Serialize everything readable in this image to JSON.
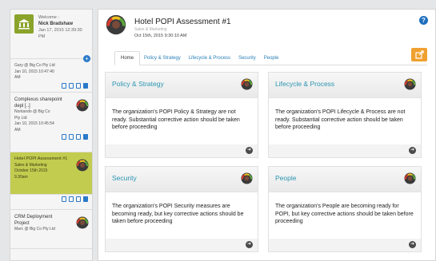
{
  "sidebar": {
    "welcome": {
      "greeting": "Welcome :",
      "name": "Nick Bradshaw",
      "datetime": "Jan 17, 2015 12:39:30",
      "ampm": "PM"
    },
    "cards": [
      {
        "title": "",
        "line1": "Gary @ Big Co Pty Ltd",
        "line2": "Jan 10, 2015 10:47:40",
        "line3": "AM"
      },
      {
        "title": "Complexus sharepoint depl [..]",
        "line1": "Nontando @ Big Co",
        "line2": "Pty Ltd",
        "line3": "Jan 10, 2015 10:45:54",
        "line4": "AM"
      },
      {
        "title": "Hotel POPI Assessment #1",
        "line1": "Sales & Marketing",
        "line2": "October 15th 2015",
        "line3": "9.30am"
      },
      {
        "title": "CRM Deployment Project",
        "line1": "Marc @ Big Co Pty Ltd"
      }
    ]
  },
  "header": {
    "title": "Hotel POPI Assessment #1",
    "subtitle": "Sales & Marketing",
    "date": "Oct 15th, 2015 9:30:10 AM",
    "help": "?"
  },
  "tabs": [
    {
      "label": "Home"
    },
    {
      "label": "Policy & Strategy"
    },
    {
      "label": "Lifecycle & Process"
    },
    {
      "label": "Security"
    },
    {
      "label": "People"
    }
  ],
  "sections": [
    {
      "title": "Policy & Strategy",
      "text": "The organization's POPI Policy & Strategy are not ready.  Substantial corrective action should be taken before proceeding"
    },
    {
      "title": "Lifecycle & Process",
      "text": "The organization's POPI Lifecycle & Process are not ready.  Substantial corrective action should be taken before proceeding"
    },
    {
      "title": "Security",
      "text": "The organization's POPI Security measures are becoming ready, but key corrective actions should be taken before proceeding"
    },
    {
      "title": "People",
      "text": "The organization's People are becoming ready for POPI, but key corrective actions should be taken before proceeding"
    }
  ],
  "colors": {
    "accent": "#2b95b2",
    "selected": "#c2cc4f",
    "export": "#f0a030",
    "link": "#2a7fb8"
  }
}
